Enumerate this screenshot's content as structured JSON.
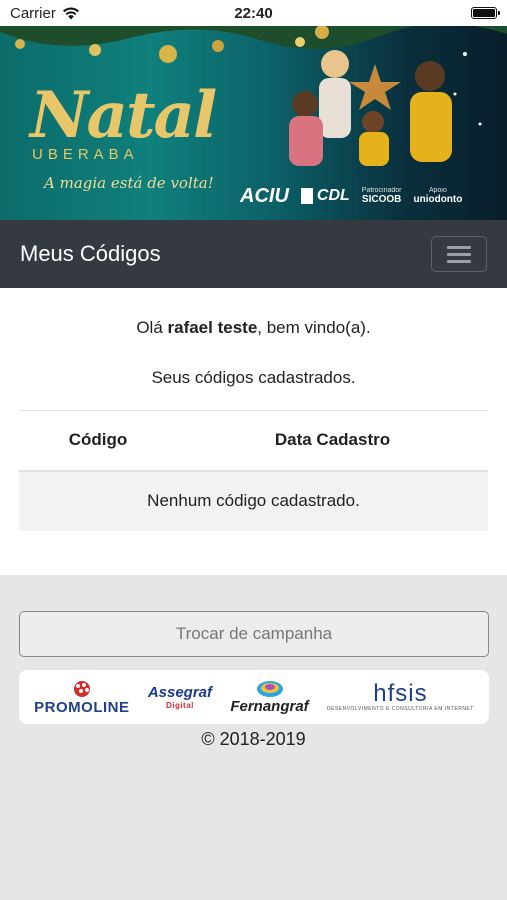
{
  "status_bar": {
    "carrier": "Carrier",
    "time": "22:40"
  },
  "banner": {
    "title": "Natal",
    "city": "UBERABA",
    "tagline": "A magia está de volta!",
    "sponsors": {
      "aciu": "ACIU",
      "cdl": "CDL",
      "sicoob_caption": "Patrocinador",
      "sicoob": "SICOOB",
      "uniodonto_caption": "Apoio",
      "uniodonto": "uniodonto"
    }
  },
  "navbar": {
    "title": "Meus Códigos"
  },
  "main": {
    "greeting_prefix": "Olá ",
    "user_name": "rafael teste",
    "greeting_suffix": ", bem vindo(a).",
    "subtitle": "Seus códigos cadastrados.",
    "table": {
      "columns": [
        "Código",
        "Data Cadastro"
      ],
      "empty_message": "Nenhum código cadastrado."
    }
  },
  "footer": {
    "campaign_button": "Trocar de campanha",
    "partners": {
      "promoline": "PROMOLINE",
      "assegraf": "Assegraf",
      "assegraf_sub": "Digital",
      "fernangraf": "Fernangraf",
      "hfsis": "hfsis",
      "hfsis_sub": "DESENVOLVIMENTO E CONSULTORIA EM INTERNET"
    },
    "copyright": "© 2018-2019"
  },
  "colors": {
    "navbar": "#343a40",
    "banner_teal": "#0c6c6a",
    "gold": "#e7c76a"
  },
  "icons": [
    "wifi-icon",
    "battery-icon",
    "menu-icon"
  ]
}
